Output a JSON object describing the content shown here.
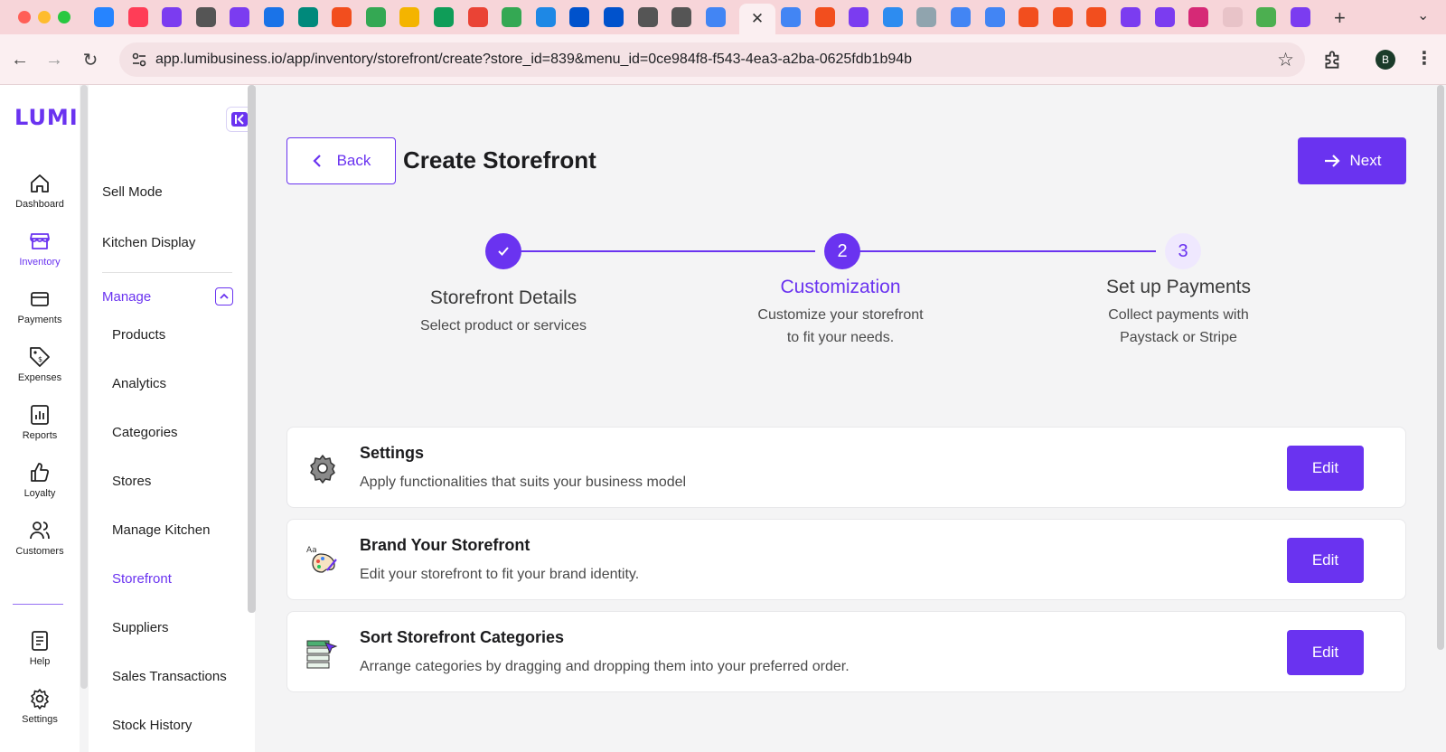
{
  "browser": {
    "tabs": [
      {
        "icon": "jira-icon",
        "color": "#2684ff"
      },
      {
        "icon": "monday-icon",
        "color": "#ff3d57"
      },
      {
        "icon": "notion-calendar-icon",
        "color": "#7b3cf0"
      },
      {
        "icon": "globe-icon",
        "color": "#555555"
      },
      {
        "icon": "notion-calendar-icon",
        "color": "#7b3cf0"
      },
      {
        "icon": "google-calendar-icon",
        "color": "#1a73e8"
      },
      {
        "icon": "google-meet-icon",
        "color": "#00897b"
      },
      {
        "icon": "figma-icon",
        "color": "#f24e1e"
      },
      {
        "icon": "google-drive-icon",
        "color": "#34a853"
      },
      {
        "icon": "google-slides-icon",
        "color": "#f4b400"
      },
      {
        "icon": "google-sheets-icon",
        "color": "#0f9d58"
      },
      {
        "icon": "gmail-icon",
        "color": "#ea4335"
      },
      {
        "icon": "google-drive-icon",
        "color": "#34a853"
      },
      {
        "icon": "skype-icon",
        "color": "#1e88e5"
      },
      {
        "icon": "confluence-icon",
        "color": "#0052cc"
      },
      {
        "icon": "confluence-icon",
        "color": "#0052cc"
      },
      {
        "icon": "globe-icon",
        "color": "#555555"
      },
      {
        "icon": "globe-icon",
        "color": "#555555"
      },
      {
        "icon": "google-docs-icon",
        "color": "#4285f4"
      }
    ],
    "tabs_right": [
      {
        "icon": "google-docs-icon",
        "color": "#4285f4"
      },
      {
        "icon": "figma-icon",
        "color": "#f24e1e"
      },
      {
        "icon": "lumi-icon",
        "color": "#7b3cf0"
      },
      {
        "icon": "todo-icon",
        "color": "#2d8cf0"
      },
      {
        "icon": "doc-icon",
        "color": "#90a4ae"
      },
      {
        "icon": "google-docs-icon",
        "color": "#4285f4"
      },
      {
        "icon": "google-icon",
        "color": "#4285f4"
      },
      {
        "icon": "figma-icon",
        "color": "#f24e1e"
      },
      {
        "icon": "figma-icon",
        "color": "#f24e1e"
      },
      {
        "icon": "figma-icon",
        "color": "#f24e1e"
      },
      {
        "icon": "notion-calendar-icon",
        "color": "#7b3cf0"
      },
      {
        "icon": "notion-calendar-icon",
        "color": "#7b3cf0"
      },
      {
        "icon": "instagram-icon",
        "color": "#d62976"
      },
      {
        "icon": "blank-icon",
        "color": "#e8c3c8"
      },
      {
        "icon": "shield-icon",
        "color": "#4caf50"
      },
      {
        "icon": "notion-calendar-icon",
        "color": "#7b3cf0"
      }
    ],
    "active_tab_close": "✕",
    "url_host": "app.lumibusiness.io",
    "url_path": "/app/inventory/storefront/create?store_id=839&menu_id=0ce984f8-f543-4ea3-a2ba-0625fdb1b94b",
    "profile_initial": "B"
  },
  "rail": {
    "logo": "LUMI",
    "items": [
      {
        "label": "Dashboard",
        "icon": "home-icon"
      },
      {
        "label": "Inventory",
        "icon": "store-icon",
        "active": true
      },
      {
        "label": "Payments",
        "icon": "card-icon"
      },
      {
        "label": "Expenses",
        "icon": "tag-icon"
      },
      {
        "label": "Reports",
        "icon": "chart-icon"
      },
      {
        "label": "Loyalty",
        "icon": "thumbs-up-icon"
      },
      {
        "label": "Customers",
        "icon": "users-icon"
      },
      {
        "label": "Help",
        "icon": "document-icon"
      },
      {
        "label": "Settings",
        "icon": "gear-icon"
      }
    ]
  },
  "submenu": {
    "top_items": [
      "Sell Mode",
      "Kitchen Display"
    ],
    "manage_label": "Manage",
    "manage_items": [
      "Products",
      "Analytics",
      "Categories",
      "Stores",
      "Manage Kitchen",
      "Storefront",
      "Suppliers",
      "Sales Transactions",
      "Stock History"
    ],
    "active_item": "Storefront"
  },
  "header": {
    "back_label": "Back",
    "title": "Create Storefront",
    "next_label": "Next"
  },
  "stepper": {
    "steps": [
      {
        "number": "✓",
        "title": "Storefront Details",
        "subtitle": "Select product or services",
        "state": "done"
      },
      {
        "number": "2",
        "title": "Customization",
        "subtitle": "Customize your storefront to fit your needs.",
        "state": "current"
      },
      {
        "number": "3",
        "title": "Set up Payments",
        "subtitle": "Collect payments with Paystack or Stripe",
        "state": "upcoming"
      }
    ]
  },
  "cards": [
    {
      "title": "Settings",
      "description": "Apply functionalities that suits your business model",
      "button": "Edit",
      "icon": "gear-icon"
    },
    {
      "title": "Brand Your Storefront",
      "description": "Edit your storefront to fit your brand identity.",
      "button": "Edit",
      "icon": "palette-icon"
    },
    {
      "title": "Sort Storefront Categories",
      "description": "Arrange categories by dragging and dropping them into your preferred order.",
      "button": "Edit",
      "icon": "sort-icon"
    }
  ],
  "colors": {
    "accent": "#6a33f0",
    "accent_light": "#efe8fe",
    "tabbar": "#f7d5d9",
    "toolbar": "#fbeff1"
  }
}
